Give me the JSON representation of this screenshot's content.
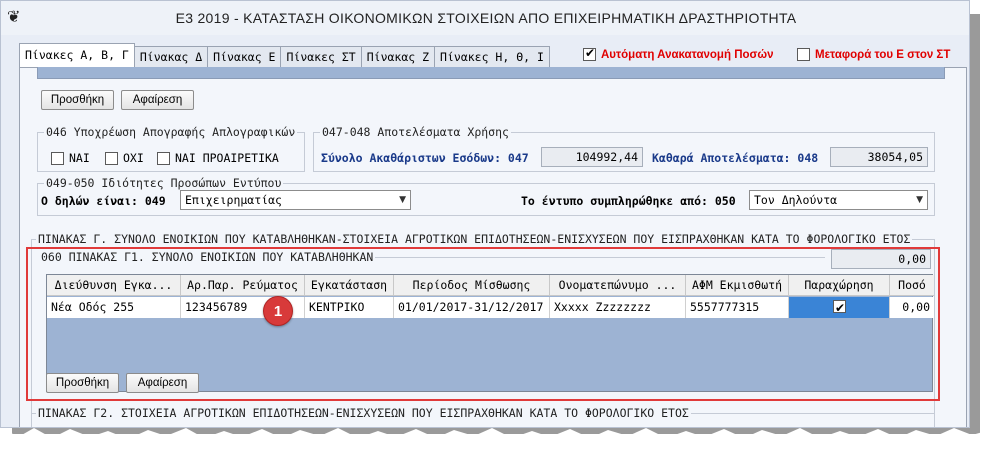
{
  "window": {
    "title": "Ε3 2019 - ΚΑΤΑΣΤΑΣΗ ΟΙΚΟΝΟΜΙΚΩΝ ΣΤΟΙΧΕΙΩΝ ΑΠΟ ΕΠΙΧΕΙΡΗΜΑΤΙΚΗ ΔΡΑΣΤΗΡΙΟΤΗΤΑ",
    "app_icon": "app-logo-icon"
  },
  "tabs": [
    {
      "label": "Πίνακες Α, Β, Γ",
      "active": true
    },
    {
      "label": "Πίνακας Δ"
    },
    {
      "label": "Πίνακας Ε"
    },
    {
      "label": "Πίνακες ΣΤ"
    },
    {
      "label": "Πίνακας Ζ"
    },
    {
      "label": "Πίνακες Η, Θ, Ι"
    }
  ],
  "options": {
    "auto_redistribution": {
      "label": "Αυτόματη Ανακατανομή Ποσών",
      "checked": true
    },
    "transfer_from_e": {
      "label": "Μεταφορά του Ε στον ΣΤ",
      "checked": false
    }
  },
  "top_buttons": {
    "add": "Προσθήκη",
    "remove": "Αφαίρεση"
  },
  "inventory": {
    "title": "046 Υποχρέωση Απογραφής Απλογραφικών",
    "options": [
      "ΝΑΙ",
      "ΟΧΙ",
      "ΝΑΙ ΠΡΟΑΙΡΕΤΙΚΑ"
    ]
  },
  "results": {
    "title": "047-048 Αποτελέσματα Χρήσης",
    "gross_income_label": "Σύνολο Ακαθάριστων Εσόδων: 047",
    "gross_income_value": "104992,44",
    "net_results_label": "Καθαρά Αποτελέσματα: 048",
    "net_results_value": "38054,05"
  },
  "properties": {
    "title": "049-050 Ιδιότητες Προσώπων Εντύπου",
    "declarant_label": "Ο δηλών είναι: 049",
    "declarant_value": "Επιχειρηματίας",
    "filled_by_label": "Το έντυπο συμπληρώθηκε από: 050",
    "filled_by_value": "Τον Δηλούντα"
  },
  "table_c": {
    "heading": "ΠΙΝΑΚΑΣ Γ. ΣΥΝΟΛΟ ΕΝΟΙΚΙΩΝ ΠΟΥ ΚΑΤΑΒΛΗΘΗΚΑΝ-ΣΤΟΙΧΕΙΑ ΑΓΡΟΤΙΚΩΝ ΕΠΙΔΟΤΗΣΕΩΝ-ΕΝΙΣΧΥΣΕΩΝ ΠΟΥ ΕΙΣΠΡΑΧΘΗΚΑΝ ΚΑΤΑ ΤΟ ΦΟΡΟΛΟΓΙΚΟ ΕΤΟΣ",
    "g1_title": "060 ΠΙΝΑΚΑΣ Γ1. ΣΥΝΟΛΟ ΕΝΟΙΚΙΩΝ ΠΟΥ ΚΑΤΑΒΛΗΘΗΚΑΝ",
    "g1_total": "0,00",
    "columns": [
      "Διεύθυνση Εγκα...",
      "Αρ.Παρ. Ρεύματος",
      "Εγκατάσταση",
      "Περίοδος Μίσθωσης",
      "Ονοματεπώνυμο ...",
      "ΑΦΜ Εκμισθωτή",
      "Παραχώρηση",
      "Ποσό"
    ],
    "rows": [
      {
        "address": "Νέα Οδός 255",
        "meter": "123456789",
        "facility": "ΚΕΝΤΡΙΚΟ",
        "period": "01/01/2017-31/12/2017",
        "name": "Xxxxx Zzzzzzzz",
        "afm": "5557777315",
        "concession": true,
        "amount": "0,00"
      }
    ],
    "add": "Προσθήκη",
    "remove": "Αφαίρεση",
    "g2_heading": "ΠΙΝΑΚΑΣ Γ2. ΣΤΟΙΧΕΙΑ ΑΓΡΟΤΙΚΩΝ ΕΠΙΔΟΤΗΣΕΩΝ-ΕΝΙΣΧΥΣΕΩΝ ΠΟΥ ΕΙΣΠΡΑΧΘΗΚΑΝ ΚΑΤΑ ΤΟ ΦΟΡΟΛΟΓΙΚΟ ΕΤΟΣ"
  },
  "callout": {
    "number": "1"
  },
  "colors": {
    "highlight": "#e03a3a",
    "selection": "#3a84d6",
    "grid_bg": "#9db3d3",
    "option_text": "#e00000"
  }
}
